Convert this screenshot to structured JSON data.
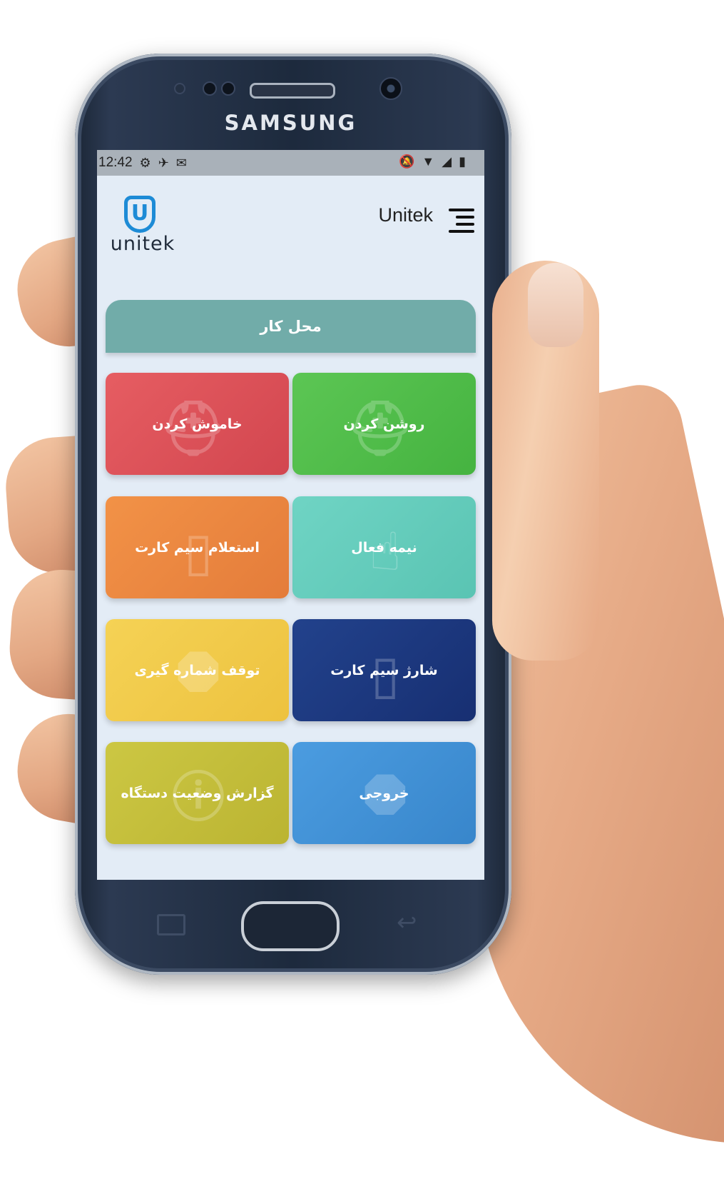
{
  "device": {
    "brand": "SAMSUNG"
  },
  "status_bar": {
    "time": "12:42",
    "left_icons": [
      "gear-icon",
      "plane-icon",
      "gmail-icon"
    ],
    "right_icons": [
      "mute-icon",
      "wifi-icon",
      "signal-icon",
      "battery-icon"
    ]
  },
  "header": {
    "logo_text": "unitek",
    "logo_mark": "U",
    "title": "Unitek"
  },
  "workplace": {
    "label": "محل کار"
  },
  "tiles": [
    {
      "id": "turn-on",
      "label": "روشن کردن",
      "color": "#55bf4f",
      "icon": "siren-icon"
    },
    {
      "id": "turn-off",
      "label": "خاموش کردن",
      "color": "#e0545a",
      "icon": "siren-icon"
    },
    {
      "id": "semi-active",
      "label": "نیمه فعال",
      "color": "#66cdbd",
      "icon": "hand-pointer-icon"
    },
    {
      "id": "sim-inquiry",
      "label": "استعلام سیم کارت",
      "color": "#ee8a42",
      "icon": "sim-card-icon"
    },
    {
      "id": "sim-charge",
      "label": "شارژ سیم کارت",
      "color": "#1d3b82",
      "icon": "sim-card-icon"
    },
    {
      "id": "stop-dialing",
      "label": "توقف شماره گیری",
      "color": "#f2cb4d",
      "icon": "stop-icon"
    },
    {
      "id": "exit",
      "label": "خروجی",
      "color": "#4492d6",
      "icon": "hand-stop-icon"
    },
    {
      "id": "device-status",
      "label": "گزارش وضعیت دستگاه",
      "color": "#c6bf3b",
      "icon": "info-icon"
    }
  ]
}
